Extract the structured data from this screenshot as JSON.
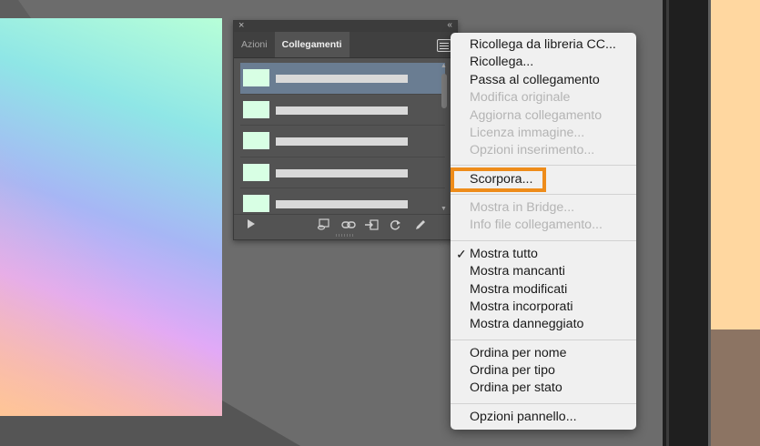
{
  "panel": {
    "close_glyph": "×",
    "collapse_glyph": "‹‹",
    "tabs": [
      {
        "label": "Azioni"
      },
      {
        "label": "Collegamenti"
      }
    ]
  },
  "context_menu": {
    "items": [
      {
        "label": "Ricollega da libreria CC...",
        "enabled": true
      },
      {
        "label": "Ricollega...",
        "enabled": true
      },
      {
        "label": "Passa al collegamento",
        "enabled": true
      },
      {
        "label": "Modifica originale",
        "enabled": false
      },
      {
        "label": "Aggiorna collegamento",
        "enabled": false
      },
      {
        "label": "Licenza immagine...",
        "enabled": false
      },
      {
        "label": "Opzioni inserimento...",
        "enabled": false
      },
      {
        "label": "Scorpora...",
        "enabled": true,
        "highlighted": true
      },
      {
        "label": "Mostra in Bridge...",
        "enabled": false
      },
      {
        "label": "Info file collegamento...",
        "enabled": false
      },
      {
        "label": "Mostra tutto",
        "enabled": true,
        "checked": true
      },
      {
        "label": "Mostra mancanti",
        "enabled": true
      },
      {
        "label": "Mostra modificati",
        "enabled": true
      },
      {
        "label": "Mostra incorporati",
        "enabled": true
      },
      {
        "label": "Mostra danneggiato",
        "enabled": true
      },
      {
        "label": "Ordina per nome",
        "enabled": true
      },
      {
        "label": "Ordina per tipo",
        "enabled": true
      },
      {
        "label": "Ordina per stato",
        "enabled": true
      },
      {
        "label": "Opzioni pannello...",
        "enabled": true
      }
    ],
    "check_glyph": "✓",
    "highlight_color": "#ee8c1a"
  },
  "colors": {
    "workspace": "#5e5e5e",
    "selected_row": "#6a7d92",
    "thumbnail": "#d8ffe4"
  }
}
